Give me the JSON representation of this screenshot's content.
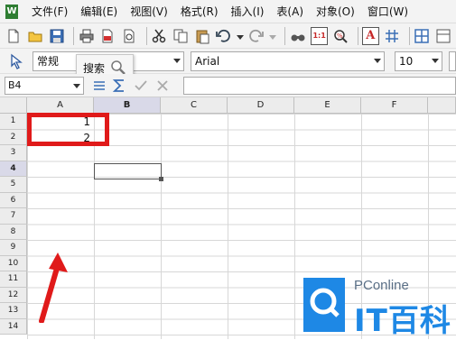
{
  "menu": {
    "app_icon": "W",
    "items": [
      "文件(F)",
      "编辑(E)",
      "视图(V)",
      "格式(R)",
      "插入(I)",
      "表(A)",
      "对象(O)",
      "窗口(W)"
    ]
  },
  "toolbar": {
    "icons": [
      "new-doc-icon",
      "open-folder-icon",
      "save-icon",
      "print-icon",
      "pdf-icon",
      "print-preview-icon",
      "cut-icon",
      "copy-icon",
      "paste-icon",
      "undo-icon",
      "redo-icon",
      "find-icon",
      "zoom-100-icon",
      "zoom-icon",
      "text-box-icon",
      "grid-icon",
      "table-icon"
    ],
    "zoom_label": "1:1",
    "text_label": "A"
  },
  "format_bar": {
    "style_value": "常规",
    "font_name": "Arial",
    "font_size": "10",
    "tooltip": "搜索"
  },
  "formula_bar": {
    "cell_ref": "B4",
    "formula": ""
  },
  "sheet": {
    "columns": [
      "A",
      "B",
      "C",
      "D",
      "E",
      "F"
    ],
    "active_column": "B",
    "rows": [
      "1",
      "2",
      "3",
      "4",
      "5",
      "6",
      "7",
      "8",
      "9",
      "10",
      "11",
      "12",
      "13",
      "14"
    ],
    "active_row": "4",
    "cells": {
      "A1": "1",
      "A2": "2"
    }
  },
  "watermark": {
    "small": "PConline",
    "big": "IT百科"
  },
  "colors": {
    "highlight": "#e01a1a",
    "accent": "#1e88e5"
  }
}
